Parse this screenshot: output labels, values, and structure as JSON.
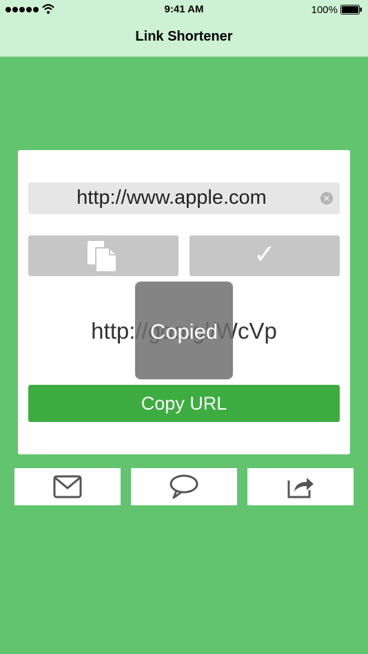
{
  "status_bar": {
    "time": "9:41 AM",
    "battery": "100%",
    "icons": [
      "signal-dots-icon",
      "wifi-icon",
      "battery-icon"
    ]
  },
  "nav": {
    "title": "Link Shortener"
  },
  "card": {
    "url_input": {
      "value": "http://www.apple.com",
      "clear_icon": "clear-icon"
    },
    "buttons": {
      "paste_icon": "paste-icon",
      "confirm_icon": "✓"
    },
    "short_url": "http://goo.gl/WcVp",
    "toast": "Copied",
    "copy_button": "Copy URL"
  },
  "share_bar": {
    "items": [
      "mail-icon",
      "message-bubble-icon",
      "share-arrow-icon"
    ]
  },
  "colors": {
    "background": "#62c46e",
    "nav_background": "#cdf1d3",
    "copy_button": "#3ead41",
    "gray_button": "#c6c6c6"
  }
}
